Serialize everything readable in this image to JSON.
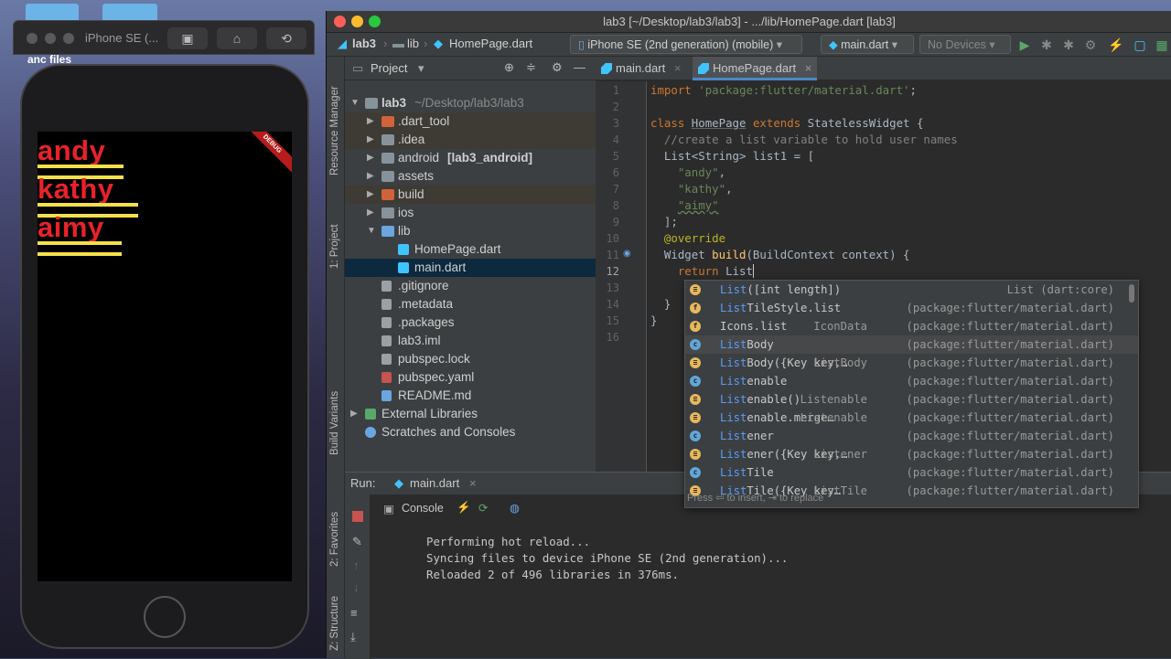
{
  "desktop": {
    "left_text": "anc files"
  },
  "simulator": {
    "title": "iPhone SE (...",
    "app_names": [
      "andy",
      "kathy",
      "aimy"
    ],
    "debug_banner": "DEBUG"
  },
  "ide": {
    "window_title": "lab3 [~/Desktop/lab3/lab3] - .../lib/HomePage.dart [lab3]",
    "breadcrumb": [
      "lab3",
      "lib",
      "HomePage.dart"
    ],
    "device_select": "iPhone SE (2nd generation) (mobile)",
    "run_config": "main.dart",
    "devices_combo": "No Devices"
  },
  "stripe": {
    "resource_manager": "Resource Manager",
    "project": "1: Project",
    "build_variants": "Build Variants",
    "favorites": "2: Favorites",
    "structure": "Z: Structure"
  },
  "project": {
    "header": "Project",
    "root": "lab3",
    "root_path": "~/Desktop/lab3/lab3",
    "items": [
      {
        "label": "lab3",
        "suffix": "~/Desktop/lab3/lab3"
      },
      {
        "label": ".dart_tool"
      },
      {
        "label": ".idea"
      },
      {
        "label": "android",
        "suffix": "[lab3_android]"
      },
      {
        "label": "assets"
      },
      {
        "label": "build"
      },
      {
        "label": "ios"
      },
      {
        "label": "lib"
      },
      {
        "label": "HomePage.dart"
      },
      {
        "label": "main.dart"
      },
      {
        "label": ".gitignore"
      },
      {
        "label": ".metadata"
      },
      {
        "label": ".packages"
      },
      {
        "label": "lab3.iml"
      },
      {
        "label": "pubspec.lock"
      },
      {
        "label": "pubspec.yaml"
      },
      {
        "label": "README.md"
      },
      {
        "label": "External Libraries"
      },
      {
        "label": "Scratches and Consoles"
      }
    ]
  },
  "editor": {
    "tabs": [
      "main.dart",
      "HomePage.dart"
    ],
    "line_numbers": [
      "1",
      "2",
      "3",
      "4",
      "5",
      "6",
      "7",
      "8",
      "9",
      "10",
      "11",
      "12",
      "13",
      "14",
      "15",
      "16"
    ]
  },
  "autocomplete": {
    "items": [
      {
        "icon": "method",
        "match": "List",
        "rest": "([int length])",
        "type": "",
        "src": "List (dart:core)"
      },
      {
        "icon": "field",
        "match": "List",
        "rest": "TileStyle.list",
        "type": "",
        "src": "(package:flutter/material.dart)"
      },
      {
        "icon": "field",
        "match": "",
        "rest": "Icons.list",
        "type": "IconData",
        "src": "(package:flutter/material.dart)"
      },
      {
        "icon": "class",
        "match": "List",
        "rest": "Body",
        "type": "",
        "src": "(package:flutter/material.dart)"
      },
      {
        "icon": "method",
        "match": "List",
        "rest": "Body({Key key,…",
        "type": "ListBody",
        "src": "(package:flutter/material.dart)"
      },
      {
        "icon": "class",
        "match": "List",
        "rest": "enable",
        "type": "",
        "src": "(package:flutter/material.dart)"
      },
      {
        "icon": "method",
        "match": "List",
        "rest": "enable()",
        "type": "Listenable",
        "src": "(package:flutter/material.dart)"
      },
      {
        "icon": "method",
        "match": "List",
        "rest": "enable.merge…",
        "type": "Listenable",
        "src": "(package:flutter/material.dart)"
      },
      {
        "icon": "class",
        "match": "List",
        "rest": "ener",
        "type": "",
        "src": "(package:flutter/material.dart)"
      },
      {
        "icon": "method",
        "match": "List",
        "rest": "ener({Key key,…",
        "type": "Listener",
        "src": "(package:flutter/material.dart)"
      },
      {
        "icon": "class",
        "match": "List",
        "rest": "Tile",
        "type": "",
        "src": "(package:flutter/material.dart)"
      },
      {
        "icon": "method",
        "match": "List",
        "rest": "Tile({Key key…",
        "type": "ListTile",
        "src": "(package:flutter/material.dart)"
      }
    ],
    "footer": "Press ⏎ to insert, ⇥ to replace"
  },
  "run": {
    "label": "Run:",
    "config": "main.dart",
    "console_tab": "Console",
    "lines": [
      "Performing hot reload...",
      "Syncing files to device iPhone SE (2nd generation)...",
      "Reloaded 2 of 496 libraries in 376ms."
    ]
  }
}
